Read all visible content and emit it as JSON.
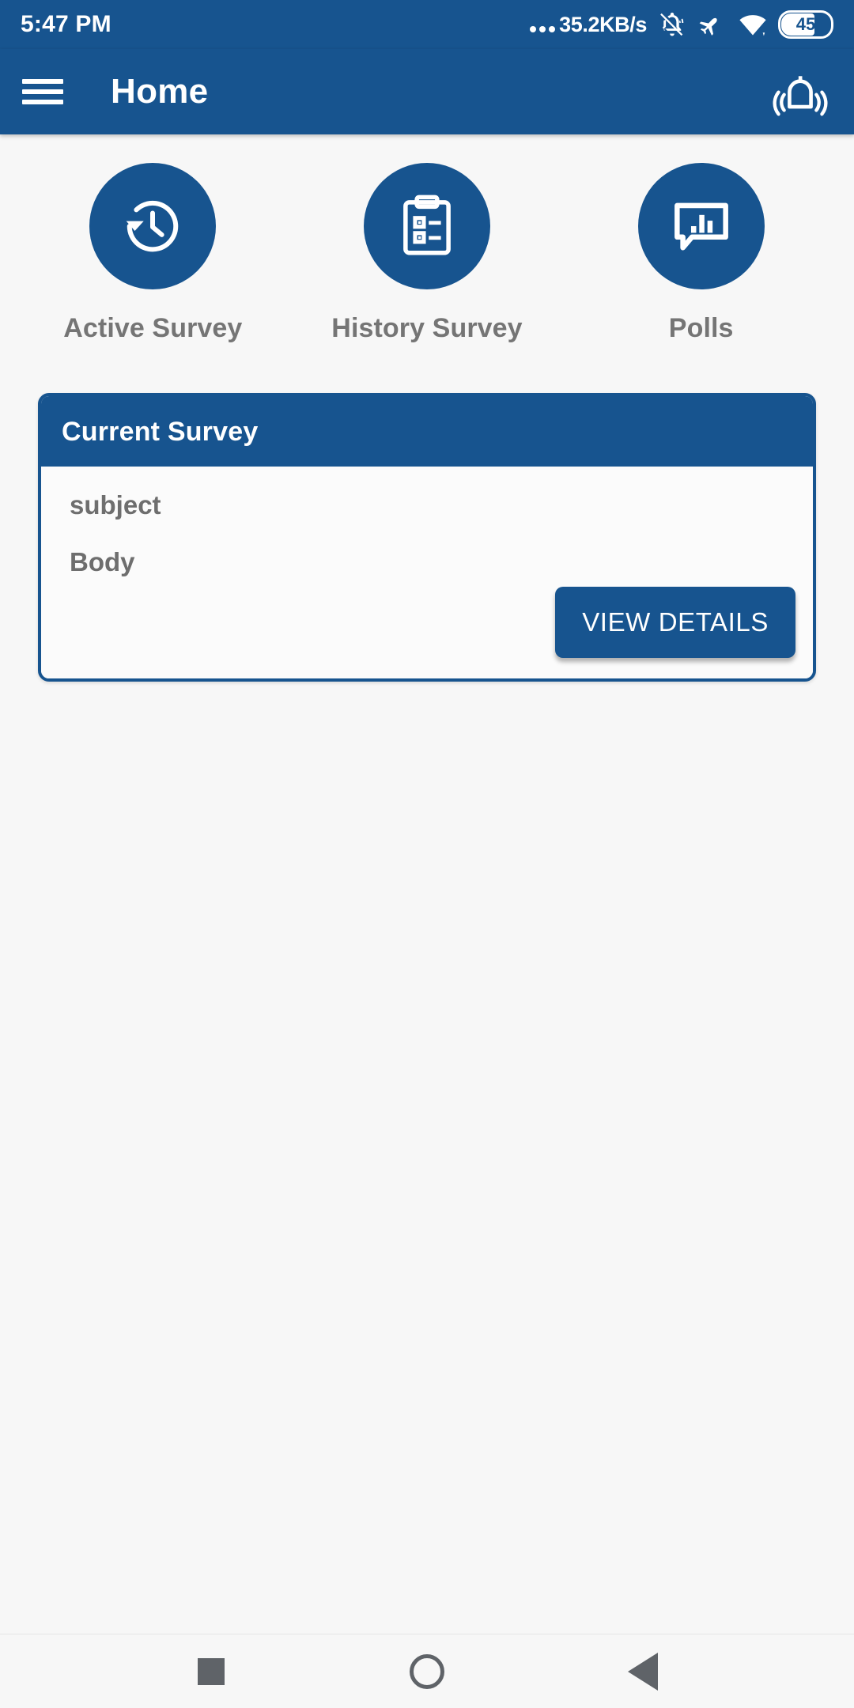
{
  "status_bar": {
    "time": "5:47 PM",
    "network_speed": "35.2KB/s",
    "icons": [
      "overflow-dots-icon",
      "bell-muted-icon",
      "airplane-mode-icon",
      "wifi-icon",
      "battery-icon"
    ],
    "battery_level": "45"
  },
  "app_bar": {
    "menu_icon": "hamburger-menu-icon",
    "title": "Home",
    "notification_icon": "bell-ringing-icon"
  },
  "shortcuts": [
    {
      "label": "Active Survey",
      "icon": "history-clock-icon"
    },
    {
      "label": "History Survey",
      "icon": "clipboard-checklist-icon"
    },
    {
      "label": "Polls",
      "icon": "poll-chat-bar-chart-icon"
    }
  ],
  "current_survey_card": {
    "header": "Current Survey",
    "subject": "subject",
    "body": "Body",
    "action_label": "VIEW DETAILS"
  },
  "nav_bar": {
    "recent_label": "recents-square-icon",
    "home_label": "home-circle-icon",
    "back_label": "back-triangle-icon"
  },
  "colors": {
    "primary": "#17548f",
    "background": "#f7f7f7",
    "card_surface": "#fbfbfb",
    "muted_text": "#6e6e6e",
    "nav_icon": "#5f6368"
  }
}
